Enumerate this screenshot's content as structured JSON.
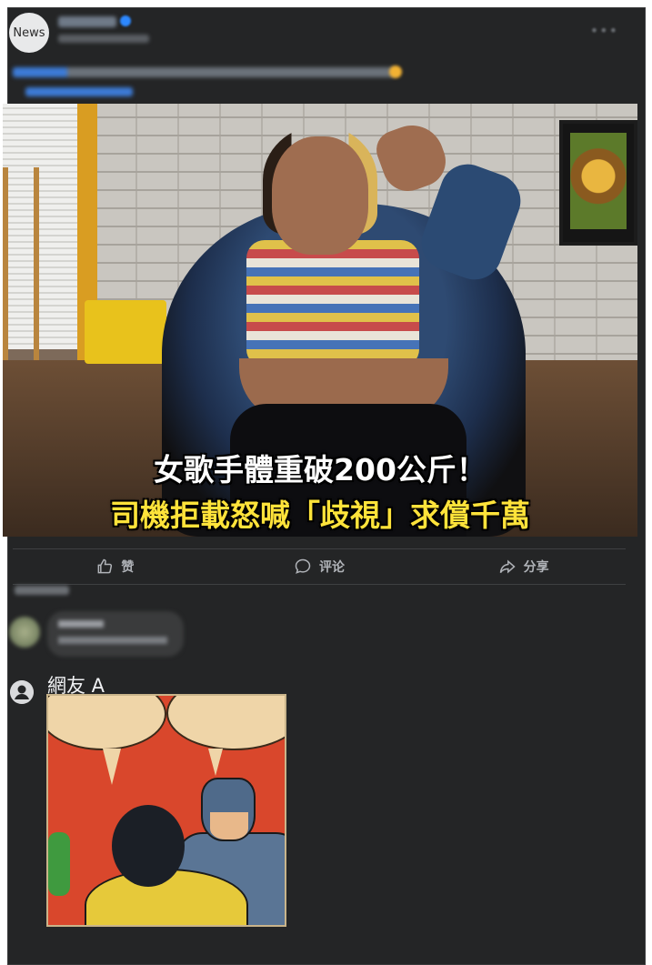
{
  "post": {
    "page_avatar_text": "News",
    "image_subtitle_line1": "女歌手體重破200公斤！",
    "image_subtitle_line2": "司機拒載怒喊「歧視」求償千萬"
  },
  "actions": {
    "like": "赞",
    "comment": "评论",
    "share": "分享"
  },
  "comment": {
    "user_name": "網友 A"
  },
  "colors": {
    "background": "#242526",
    "subtitle_white": "#ffffff",
    "subtitle_yellow": "#ffe33a",
    "action_text": "#b0b3b8"
  }
}
